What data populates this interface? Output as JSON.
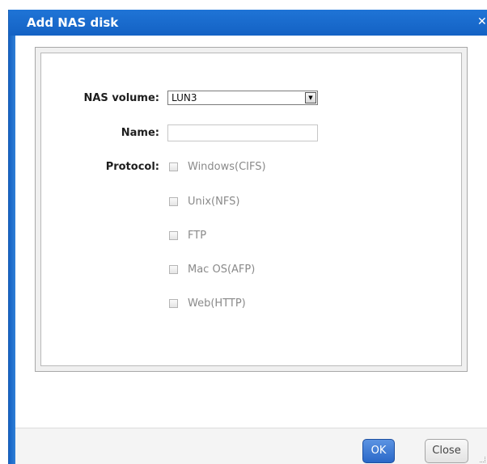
{
  "dialog": {
    "title": "Add NAS disk",
    "close_glyph": "✕",
    "accent_color": "#1462c4"
  },
  "form": {
    "nas_volume": {
      "label": "NAS volume:",
      "value": "LUN3",
      "dropdown_glyph": "▼"
    },
    "name": {
      "label": "Name:",
      "value": "",
      "placeholder": ""
    },
    "protocol": {
      "label": "Protocol:",
      "options": [
        {
          "label": "Windows(CIFS)",
          "checked": false,
          "disabled": true
        },
        {
          "label": "Unix(NFS)",
          "checked": false,
          "disabled": true
        },
        {
          "label": "FTP",
          "checked": false,
          "disabled": true
        },
        {
          "label": "Mac OS(AFP)",
          "checked": false,
          "disabled": true
        },
        {
          "label": "Web(HTTP)",
          "checked": false,
          "disabled": true
        }
      ]
    }
  },
  "footer": {
    "ok_label": "OK",
    "close_label": "Close"
  }
}
